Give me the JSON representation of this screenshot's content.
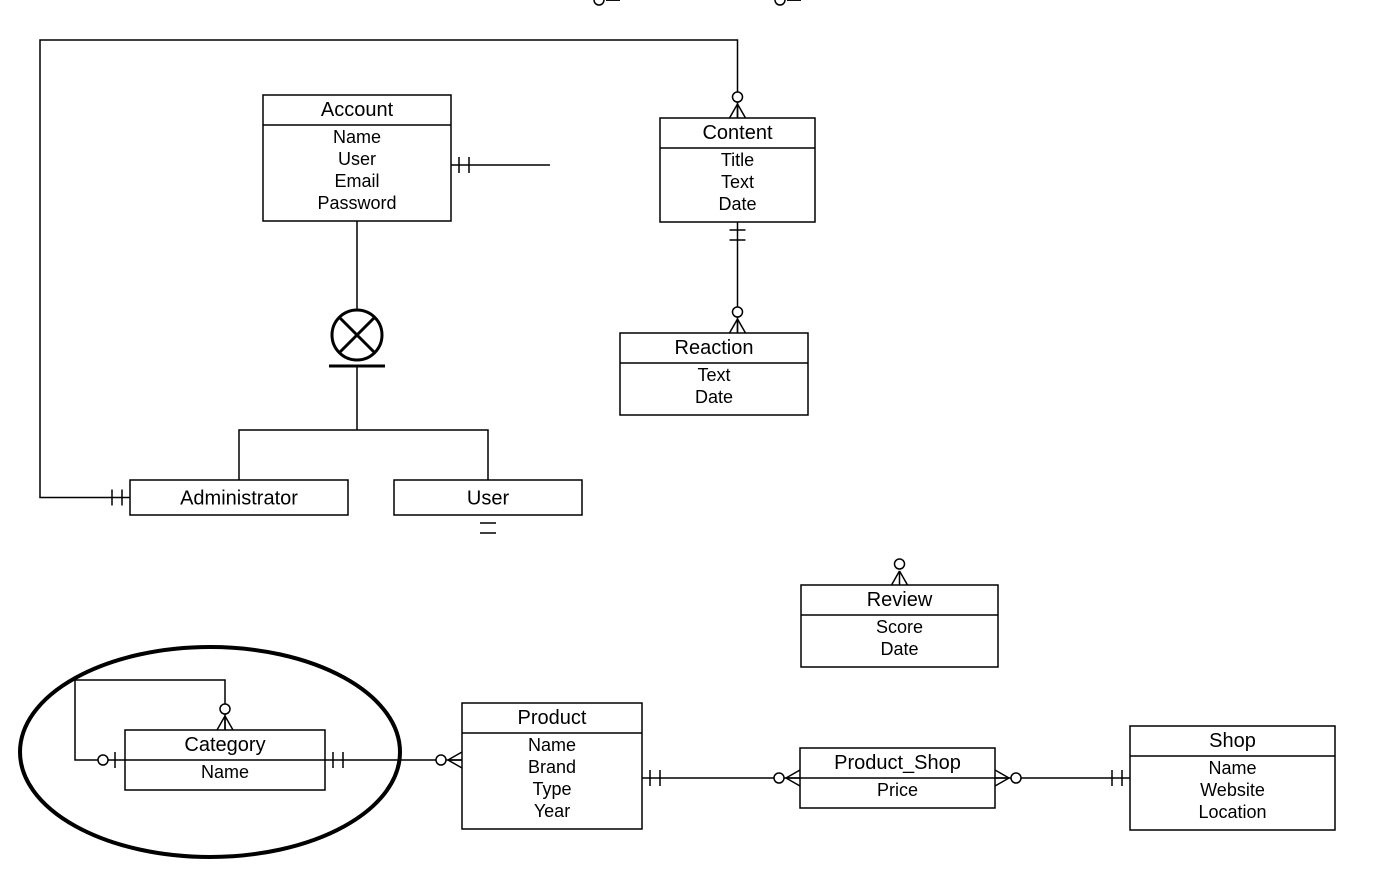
{
  "entities": {
    "account": {
      "title": "Account",
      "attrs": [
        "Name",
        "User",
        "Email",
        "Password"
      ]
    },
    "content": {
      "title": "Content",
      "attrs": [
        "Title",
        "Text",
        "Date"
      ]
    },
    "reaction": {
      "title": "Reaction",
      "attrs": [
        "Text",
        "Date"
      ]
    },
    "administrator": {
      "title": "Administrator",
      "attrs": []
    },
    "user": {
      "title": "User",
      "attrs": []
    },
    "review": {
      "title": "Review",
      "attrs": [
        "Score",
        "Date"
      ]
    },
    "category": {
      "title": "Category",
      "attrs": [
        "Name"
      ]
    },
    "product": {
      "title": "Product",
      "attrs": [
        "Name",
        "Brand",
        "Type",
        "Year"
      ]
    },
    "product_shop": {
      "title": "Product_Shop",
      "attrs": [
        "Price"
      ]
    },
    "shop": {
      "title": "Shop",
      "attrs": [
        "Name",
        "Website",
        "Location"
      ]
    }
  }
}
